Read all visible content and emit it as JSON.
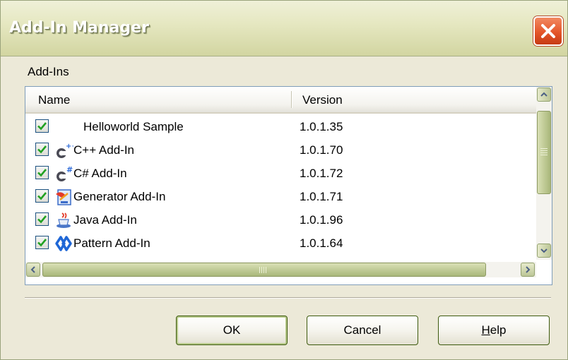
{
  "window": {
    "title": "Add-In Manager"
  },
  "group_label": "Add-Ins",
  "columns": {
    "name": "Name",
    "version": "Version"
  },
  "rows": [
    {
      "name": "Helloworld Sample",
      "version": "1.0.1.35",
      "checked": true,
      "icon": "none"
    },
    {
      "name": "C++ Add-In",
      "version": "1.0.1.70",
      "checked": true,
      "icon": "cpp-addin-icon"
    },
    {
      "name": "C# Add-In",
      "version": "1.0.1.72",
      "checked": true,
      "icon": "csharp-addin-icon"
    },
    {
      "name": "Generator Add-In",
      "version": "1.0.1.71",
      "checked": true,
      "icon": "generator-addin-icon"
    },
    {
      "name": "Java Add-In",
      "version": "1.0.1.96",
      "checked": true,
      "icon": "java-addin-icon"
    },
    {
      "name": "Pattern Add-In",
      "version": "1.0.1.64",
      "checked": true,
      "icon": "pattern-addin-icon"
    }
  ],
  "buttons": {
    "ok": "OK",
    "cancel": "Cancel",
    "help_mnemonic": "H",
    "help_rest": "elp"
  },
  "colors": {
    "titlebar": "#D2D5A1",
    "close_button": "#E4562A",
    "checkmark": "#21A121",
    "listview_border": "#7F9DB9",
    "scrollbar_thumb": "#A9B77A"
  }
}
